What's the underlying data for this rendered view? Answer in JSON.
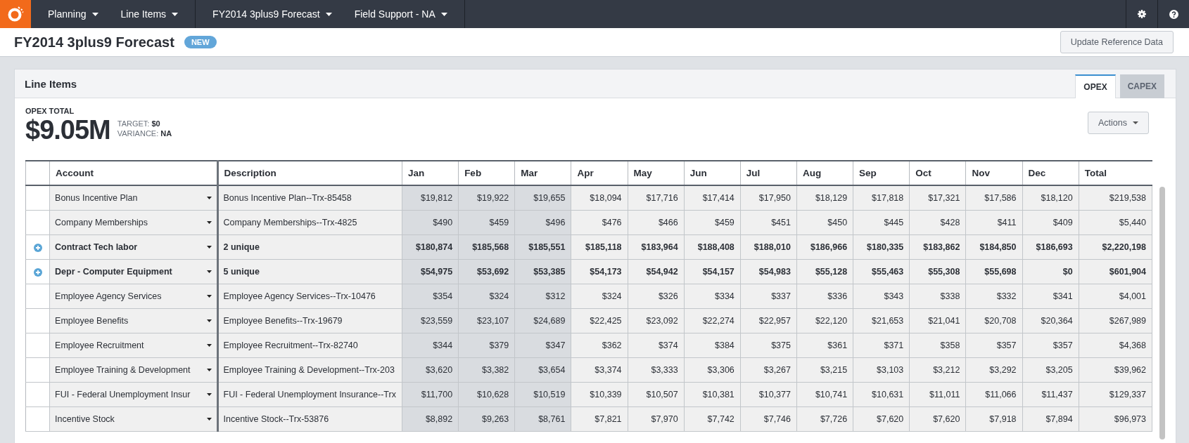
{
  "nav": {
    "groups": [
      [
        "Planning",
        "Line Items"
      ],
      [
        "FY2014 3plus9 Forecast",
        "Field Support - NA"
      ]
    ]
  },
  "header": {
    "title": "FY2014 3plus9 Forecast",
    "badge": "NEW",
    "button": "Update Reference Data"
  },
  "panel": {
    "title": "Line Items",
    "tabs": [
      {
        "label": "OPEX",
        "selected": true
      },
      {
        "label": "CAPEX",
        "selected": false
      }
    ],
    "summary": {
      "label": "OPEX TOTAL",
      "value": "$9.05M",
      "target_label": "TARGET:",
      "target": "$0",
      "variance_label": "VARIANCE:",
      "variance": "NA"
    },
    "actions_button": "Actions"
  },
  "table": {
    "columns": [
      {
        "label": "Account"
      },
      {
        "label": "Description"
      },
      {
        "label": "Jan",
        "actual": true
      },
      {
        "label": "Feb",
        "actual": true
      },
      {
        "label": "Mar",
        "actual": true
      },
      {
        "label": "Apr",
        "actual": false
      },
      {
        "label": "May",
        "actual": false
      },
      {
        "label": "Jun",
        "actual": false
      },
      {
        "label": "Jul",
        "actual": false
      },
      {
        "label": "Aug",
        "actual": false
      },
      {
        "label": "Sep",
        "actual": false
      },
      {
        "label": "Oct",
        "actual": false
      },
      {
        "label": "Nov",
        "actual": false
      },
      {
        "label": "Dec",
        "actual": false
      },
      {
        "label": "Total",
        "actual": false
      }
    ],
    "rows": [
      {
        "kind": "item",
        "account": "Bonus Incentive Plan",
        "description": "Bonus Incentive Plan--Trx-85458",
        "values": [
          "$19,812",
          "$19,922",
          "$19,655",
          "$18,094",
          "$17,716",
          "$17,414",
          "$17,950",
          "$18,129",
          "$17,818",
          "$17,321",
          "$17,586",
          "$18,120",
          "$219,538"
        ]
      },
      {
        "kind": "item",
        "account": "Company Memberships",
        "description": "Company Memberships--Trx-4825",
        "values": [
          "$490",
          "$459",
          "$496",
          "$476",
          "$466",
          "$459",
          "$451",
          "$450",
          "$445",
          "$428",
          "$411",
          "$409",
          "$5,440"
        ]
      },
      {
        "kind": "group",
        "expanded": false,
        "account": "Contract Tech labor",
        "description": "2 unique",
        "values": [
          "$180,874",
          "$185,568",
          "$185,551",
          "$185,118",
          "$183,964",
          "$188,408",
          "$188,010",
          "$186,966",
          "$180,335",
          "$183,862",
          "$184,850",
          "$186,693",
          "$2,220,198"
        ]
      },
      {
        "kind": "group",
        "expanded": false,
        "account": "Depr - Computer Equipment",
        "description": "5 unique",
        "values": [
          "$54,975",
          "$53,692",
          "$53,385",
          "$54,173",
          "$54,942",
          "$54,157",
          "$54,983",
          "$55,128",
          "$55,463",
          "$55,308",
          "$55,698",
          "$0",
          "$601,904"
        ]
      },
      {
        "kind": "item",
        "account": "Employee Agency Services",
        "description": "Employee Agency Services--Trx-10476",
        "values": [
          "$354",
          "$324",
          "$312",
          "$324",
          "$326",
          "$334",
          "$337",
          "$336",
          "$343",
          "$338",
          "$332",
          "$341",
          "$4,001"
        ]
      },
      {
        "kind": "item",
        "account": "Employee Benefits",
        "description": "Employee Benefits--Trx-19679",
        "values": [
          "$23,559",
          "$23,107",
          "$24,689",
          "$22,425",
          "$23,092",
          "$22,274",
          "$22,957",
          "$22,120",
          "$21,653",
          "$21,041",
          "$20,708",
          "$20,364",
          "$267,989"
        ]
      },
      {
        "kind": "item",
        "account": "Employee Recruitment",
        "description": "Employee Recruitment--Trx-82740",
        "values": [
          "$344",
          "$379",
          "$347",
          "$362",
          "$374",
          "$384",
          "$375",
          "$361",
          "$371",
          "$358",
          "$357",
          "$357",
          "$4,368"
        ]
      },
      {
        "kind": "item",
        "account": "Employee Training & Development",
        "description": "Employee Training & Development--Trx-203",
        "values": [
          "$3,620",
          "$3,382",
          "$3,654",
          "$3,374",
          "$3,333",
          "$3,306",
          "$3,267",
          "$3,215",
          "$3,103",
          "$3,212",
          "$3,292",
          "$3,205",
          "$39,962"
        ]
      },
      {
        "kind": "item",
        "account": "FUI - Federal Unemployment Insur",
        "description": "FUI - Federal Unemployment Insurance--Trx",
        "values": [
          "$11,700",
          "$10,628",
          "$10,519",
          "$10,339",
          "$10,507",
          "$10,381",
          "$10,377",
          "$10,741",
          "$10,631",
          "$11,011",
          "$11,066",
          "$11,437",
          "$129,337"
        ]
      },
      {
        "kind": "item",
        "account": "Incentive Stock",
        "description": "Incentive Stock--Trx-53876",
        "values": [
          "$8,892",
          "$9,263",
          "$8,761",
          "$7,821",
          "$7,970",
          "$7,742",
          "$7,746",
          "$7,726",
          "$7,620",
          "$7,620",
          "$7,918",
          "$7,894",
          "$96,973"
        ]
      }
    ]
  }
}
